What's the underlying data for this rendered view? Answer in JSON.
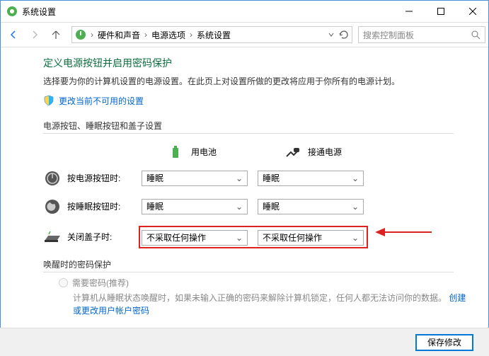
{
  "window": {
    "title": "系统设置"
  },
  "breadcrumb": {
    "segments": [
      "硬件和声音",
      "电源选项",
      "系统设置"
    ]
  },
  "search": {
    "placeholder": "搜索控制面板"
  },
  "page": {
    "heading": "定义电源按钮并启用密码保护",
    "desc": "选择要为你的计算机设置的电源设置。在此页上对设置所做的更改将应用于你所有的电源计划。",
    "admin_link": "更改当前不可用的设置"
  },
  "section1": {
    "title": "电源按钮、睡眠按钮和盖子设置",
    "col_battery": "用电池",
    "col_plugged": "接通电源",
    "rows": [
      {
        "label": "按电源按钮时:",
        "battery": "睡眠",
        "plugged": "睡眠"
      },
      {
        "label": "按睡眠按钮时:",
        "battery": "睡眠",
        "plugged": "睡眠"
      },
      {
        "label": "关闭盖子时:",
        "battery": "不采取任何操作",
        "plugged": "不采取任何操作"
      }
    ]
  },
  "section2": {
    "title": "唤醒时的密码保护",
    "radio1_label": "需要密码(推荐)",
    "radio1_desc": "计算机从睡眠状态唤醒时，如果未输入正确的密码来解除计算机锁定，任何人都无法访问你的数据。",
    "link": "创建或更改用户帐户密码"
  },
  "footer": {
    "save": "保存修改"
  }
}
